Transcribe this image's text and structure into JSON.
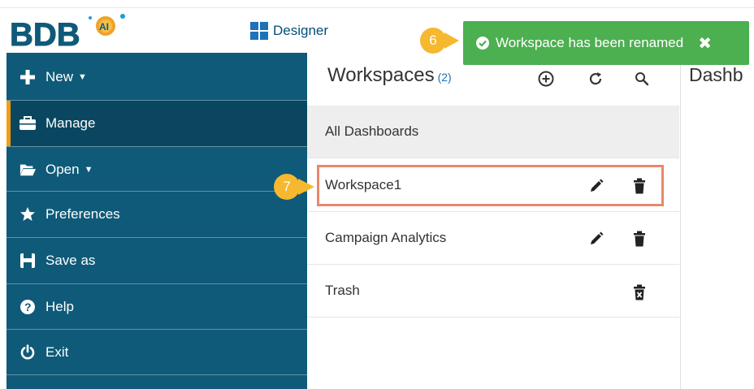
{
  "header": {
    "logo_text": "BDB",
    "logo_badge": "AI",
    "designer_label": "Designer"
  },
  "sidebar": {
    "items": [
      {
        "label": "New",
        "icon": "plus-icon",
        "has_caret": true
      },
      {
        "label": "Manage",
        "icon": "briefcase-icon",
        "active": true
      },
      {
        "label": "Open",
        "icon": "folder-open-icon",
        "has_caret": true
      },
      {
        "label": "Preferences",
        "icon": "star-icon"
      },
      {
        "label": "Save as",
        "icon": "save-icon"
      },
      {
        "label": "Help",
        "icon": "help-circle-icon"
      },
      {
        "label": "Exit",
        "icon": "power-icon"
      }
    ]
  },
  "workspaces": {
    "title": "Workspaces",
    "count": "(2)",
    "rows": [
      {
        "label": "All Dashboards"
      },
      {
        "label": "Workspace1",
        "actions": [
          "edit-icon",
          "delete-icon"
        ],
        "highlighted": true
      },
      {
        "label": "Campaign Analytics",
        "actions": [
          "edit-icon",
          "delete-icon"
        ]
      },
      {
        "label": "Trash",
        "actions": [
          "trash-empty-icon"
        ]
      }
    ]
  },
  "right_panel": {
    "title": "Dashb"
  },
  "toast": {
    "message": "Workspace has been renamed",
    "close_glyph": "✖",
    "color": "#4caf50"
  },
  "markers": [
    {
      "number": "6",
      "color": "#f5b82e"
    },
    {
      "number": "7",
      "color": "#f5b82e"
    }
  ],
  "colors": {
    "sidebar": "#0f5a78",
    "sidebar_active": "#0a4660",
    "accent": "#f39c12",
    "highlight_border": "#e8896a",
    "brand_blue": "#1d72b8"
  }
}
